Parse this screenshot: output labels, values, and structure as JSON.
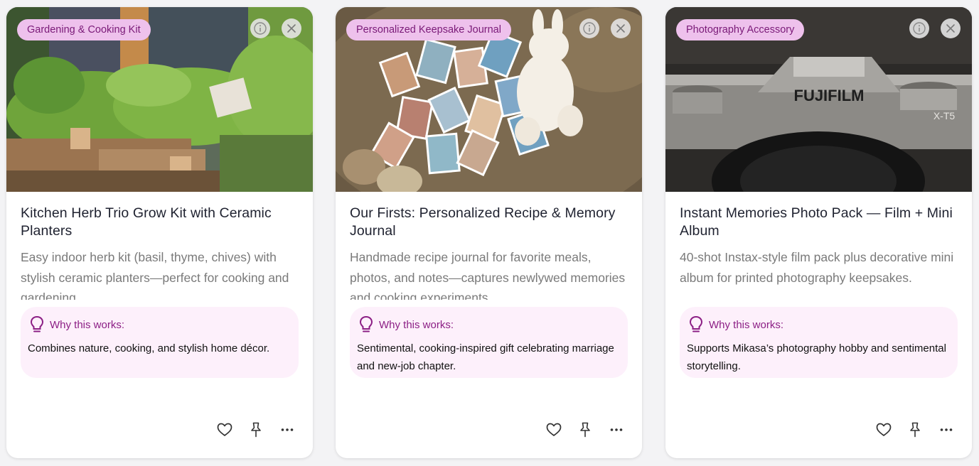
{
  "cards": [
    {
      "tag": "Gardening & Cooking Kit",
      "title": "Kitchen Herb Trio Grow Kit with Ceramic Planters",
      "description": "Easy indoor herb kit (basil, thyme, chives) with stylish ceramic planters—perfect for cooking and gardening.",
      "why_label": "Why this works:",
      "why_text": "Combines nature, cooking, and stylish home décor."
    },
    {
      "tag": "Personalized Keepsake Journal",
      "title": "Our Firsts: Personalized Recipe & Memory Journal",
      "description": "Handmade recipe journal for favorite meals, photos, and notes—captures newlywed memories and cooking experiments.",
      "why_label": "Why this works:",
      "why_text": "Sentimental, cooking-inspired gift celebrating marriage and new-job chapter."
    },
    {
      "tag": "Photography Accessory",
      "title": "Instant Memories Photo Pack — Film + Mini Album",
      "description": "40-shot Instax-style film pack plus decorative mini album for printed photography keepsakes.",
      "why_label": "Why this works:",
      "why_text": "Supports Mikasa’s photography hobby and sentimental storytelling.",
      "camera_brand": "FUJIFILM",
      "camera_model": "X-T5"
    }
  ],
  "icons": {
    "info": "info-icon",
    "close": "close-icon",
    "bulb": "lightbulb-icon",
    "like": "heart-icon",
    "pin": "pin-icon",
    "more": "more-icon"
  },
  "colors": {
    "tag_bg": "#eec1ec",
    "tag_text": "#7a1a78",
    "why_bg": "#fdf0fb",
    "why_accent": "#8c1f85"
  }
}
